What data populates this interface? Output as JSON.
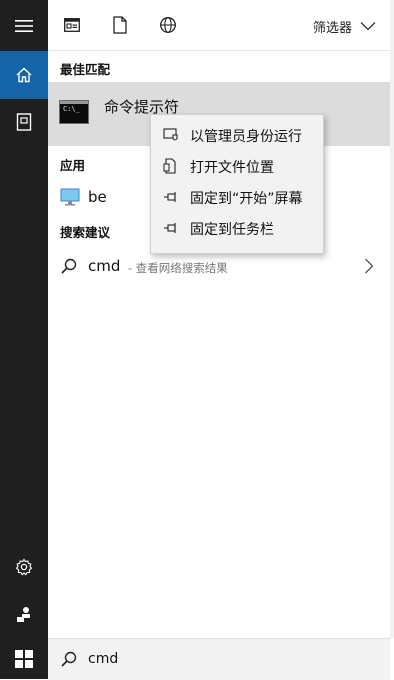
{
  "toolbar": {
    "filter_label": "筛选器"
  },
  "sections": {
    "best_match": "最佳匹配",
    "apps": "应用",
    "search_suggestions": "搜索建议"
  },
  "best_match": {
    "title": "命令提示符"
  },
  "apps": {
    "item_visible": "be"
  },
  "web_suggestion": {
    "query": "cmd",
    "hint": "- 查看网络搜索结果"
  },
  "context_menu": {
    "items": [
      {
        "label": "以管理员身份运行",
        "icon": "admin-shield-icon"
      },
      {
        "label": "打开文件位置",
        "icon": "file-location-icon"
      },
      {
        "label": "固定到“开始”屏幕",
        "icon": "pin-icon"
      },
      {
        "label": "固定到任务栏",
        "icon": "pin-icon"
      }
    ]
  },
  "search_box": {
    "value": "cmd"
  },
  "colors": {
    "rail_bg": "#1f1f1f",
    "active_blue": "#1565a8",
    "highlight_row": "#dcdcdc",
    "menu_bg": "#f2f2f2"
  }
}
